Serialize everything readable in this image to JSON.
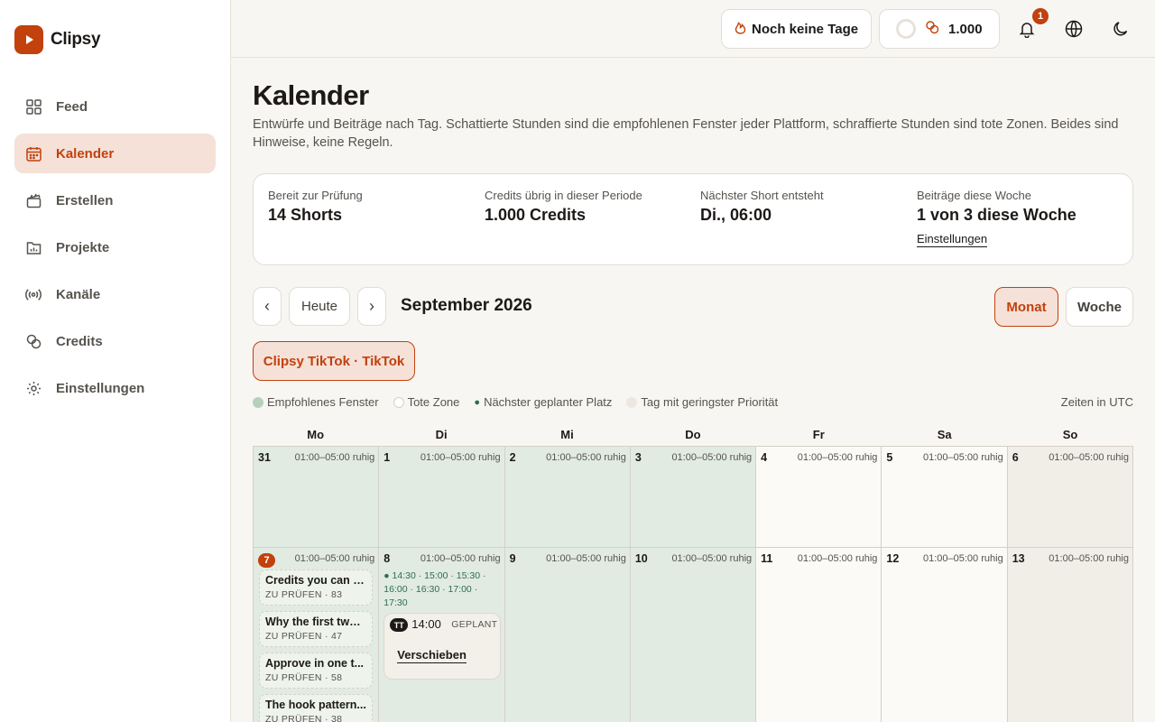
{
  "brand": {
    "name": "Clipsy"
  },
  "nav": [
    {
      "label": "Feed",
      "icon": "grid-icon"
    },
    {
      "label": "Kalender",
      "icon": "calendar-icon",
      "active": true
    },
    {
      "label": "Erstellen",
      "icon": "clapperboard-icon"
    },
    {
      "label": "Projekte",
      "icon": "folder-chart-icon"
    },
    {
      "label": "Kanäle",
      "icon": "broadcast-icon"
    },
    {
      "label": "Credits",
      "icon": "coins-icon"
    },
    {
      "label": "Einstellungen",
      "icon": "gear-icon"
    }
  ],
  "topbar": {
    "streak_label": "Noch keine Tage",
    "credits_value": "1.000",
    "notification_count": "1"
  },
  "page": {
    "title": "Kalender",
    "subtitle": "Entwürfe und Beiträge nach Tag. Schattierte Stunden sind die empfohlenen Fenster jeder Plattform, schraffierte Stunden sind tote Zonen. Beides sind Hinweise, keine Regeln."
  },
  "stats": [
    {
      "label": "Bereit zur Prüfung",
      "value": "14 Shorts"
    },
    {
      "label": "Credits übrig in dieser Periode",
      "value": "1.000 Credits"
    },
    {
      "label": "Nächster Short entsteht",
      "value": "Di., 06:00"
    },
    {
      "label": "Beiträge diese Woche",
      "value": "1 von 3 diese Woche",
      "link": "Einstellungen"
    }
  ],
  "controls": {
    "prev": "‹",
    "today": "Heute",
    "next": "›",
    "month": "September 2026",
    "view_month": "Monat",
    "view_week": "Woche",
    "channel": "Clipsy TikTok · TikTok"
  },
  "legend": {
    "recommended": "Empfohlenes Fenster",
    "dead": "Tote Zone",
    "next_slot": "Nächster geplanter Platz",
    "low_priority": "Tag mit geringster Priorität",
    "timezone": "Zeiten in UTC"
  },
  "weekdays": [
    "Mo",
    "Di",
    "Mi",
    "Do",
    "Fr",
    "Sa",
    "So"
  ],
  "quiet_label": "01:00–05:00 ruhig",
  "week1": [
    "31",
    "1",
    "2",
    "3",
    "4",
    "5",
    "6"
  ],
  "week2": [
    "7",
    "8",
    "9",
    "10",
    "11",
    "12",
    "13"
  ],
  "drafts": [
    {
      "title": "Credits you can s...",
      "meta": "ZU PRÜFEN · 83"
    },
    {
      "title": "Why the first two ...",
      "meta": "ZU PRÜFEN · 47"
    },
    {
      "title": "Approve in one t...",
      "meta": "ZU PRÜFEN · 58"
    },
    {
      "title": "The hook pattern...",
      "meta": "ZU PRÜFEN · 38"
    }
  ],
  "slots_text": "● 14:30 · 15:00 · 15:30 · 16:00 · 16:30 · 17:00 · 17:30",
  "scheduled": {
    "platform": "TT",
    "time": "14:00",
    "status": "GEPLANT",
    "action": "Verschieben"
  },
  "colors": {
    "accent": "#c2410c",
    "accent_bg": "#f5e1d8",
    "recommended_bg": "#e1ebe1",
    "low_priority_bg": "#f1eee8",
    "slot_green": "#2f6e4a"
  }
}
